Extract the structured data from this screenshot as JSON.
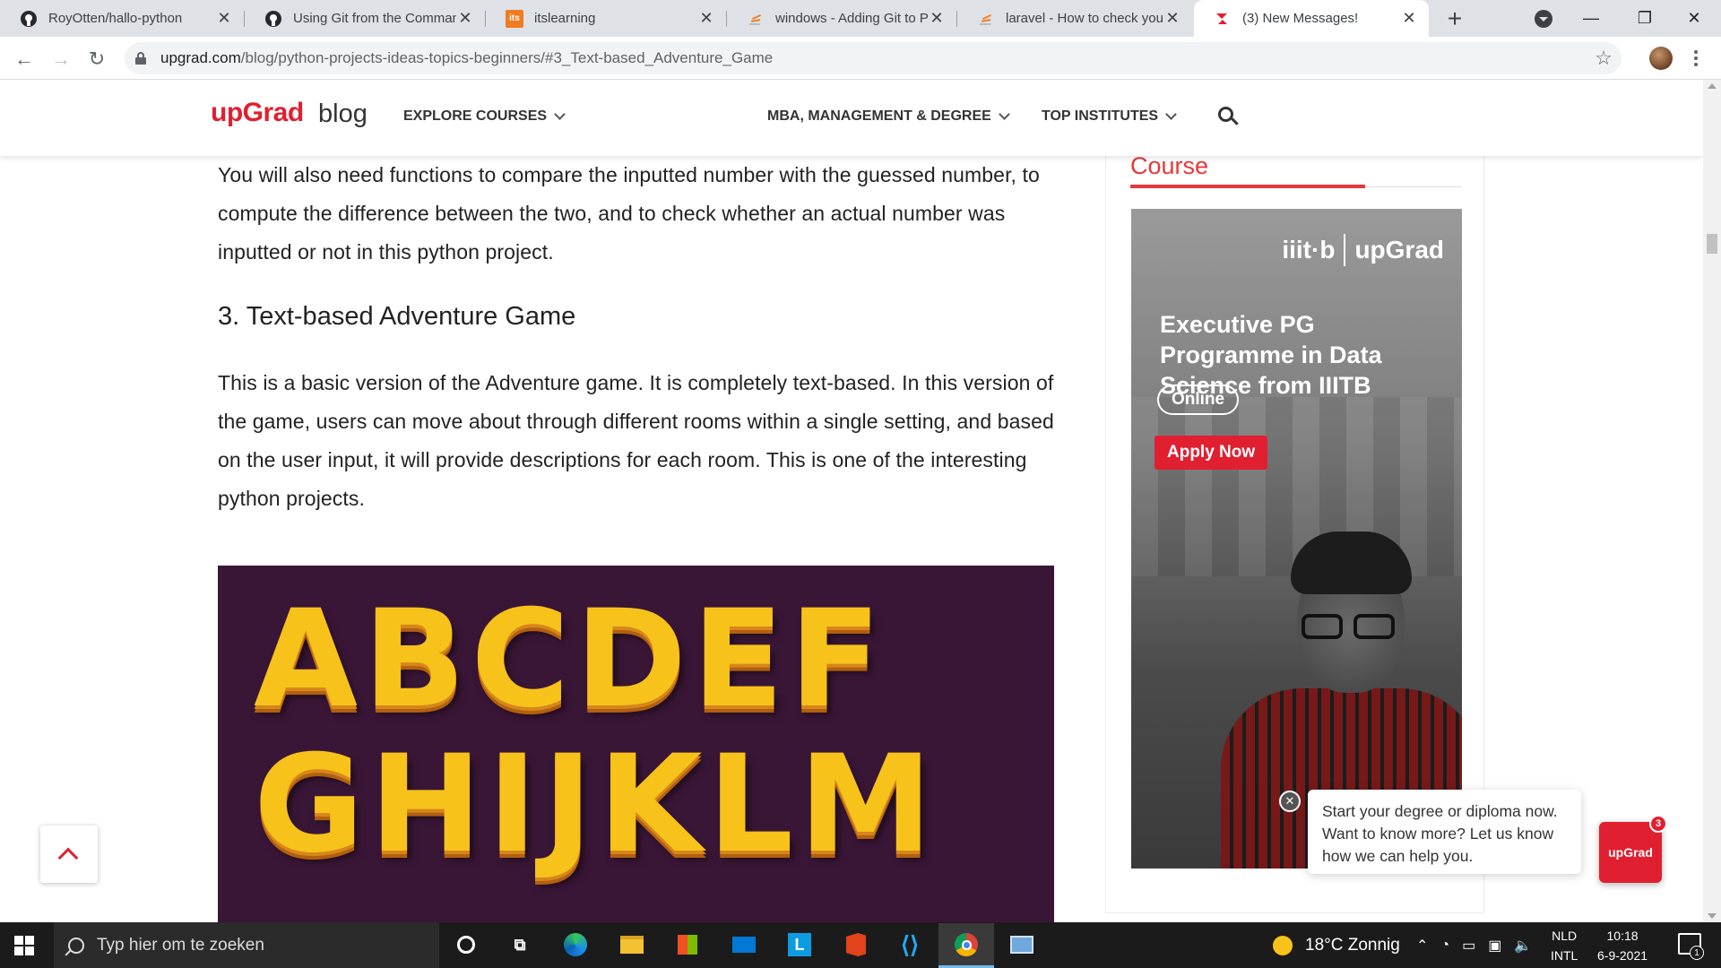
{
  "browser": {
    "tabs": [
      {
        "title": "RoyOtten/hallo-python",
        "icon": "github-icon"
      },
      {
        "title": "Using Git from the Comman",
        "icon": "github-icon"
      },
      {
        "title": "itslearning",
        "icon": "itslearning-icon"
      },
      {
        "title": "windows - Adding Git to PA",
        "icon": "stackoverflow-icon"
      },
      {
        "title": "laravel - How to check your",
        "icon": "stackoverflow-icon"
      },
      {
        "title": "(3) New Messages!",
        "icon": "upgrad-icon"
      }
    ],
    "new_tab_symbol": "+",
    "url_host": "upgrad.com",
    "url_path": "/blog/python-projects-ideas-topics-beginners/#3_Text-based_Adventure_Game",
    "itslearning_favicon_text": "its"
  },
  "site": {
    "logo": "upGrad",
    "logo_suffix": "blog",
    "nav": [
      {
        "label": "EXPLORE COURSES"
      },
      {
        "label": "MBA, MANAGEMENT & DEGREE"
      },
      {
        "label": "TOP INSTITUTES"
      }
    ],
    "accent_color": "#e02031"
  },
  "article": {
    "intro_paragraph": "You will also need functions to compare the inputted number with the guessed number, to compute the difference between the two, and to check whether an actual number was inputted or not in this python project.",
    "heading": "3. Text-based Adventure Game",
    "body_paragraph": "This is a basic version of the Adventure game. It is completely text-based. In this version of the game, users can move about through different rooms within a single setting, and based on the user input, it will provide descriptions for each room. This is one of the interesting python projects.",
    "image_letters_row1": "ABCDEF",
    "image_letters_row2": "GHIJKLM"
  },
  "sidebar": {
    "title": "Course",
    "ad": {
      "partner_logo": "iiit-b",
      "brand": "upGrad",
      "headline": "Executive PG Programme in Data Science from IIITB",
      "badge": "Online",
      "cta": "Apply Now"
    }
  },
  "chat": {
    "message": "Start your degree or diploma now. Want to know more? Let us know how we can help you.",
    "close_symbol": "✕",
    "launcher_label": "upGrad",
    "unread_count": "3"
  },
  "taskbar": {
    "search_placeholder": "Typ hier om te zoeken",
    "weather": "18°C Zonnig",
    "language_top": "NLD",
    "language_bottom": "INTL",
    "time": "10:18",
    "date": "6-9-2021",
    "notification_count": "1"
  }
}
